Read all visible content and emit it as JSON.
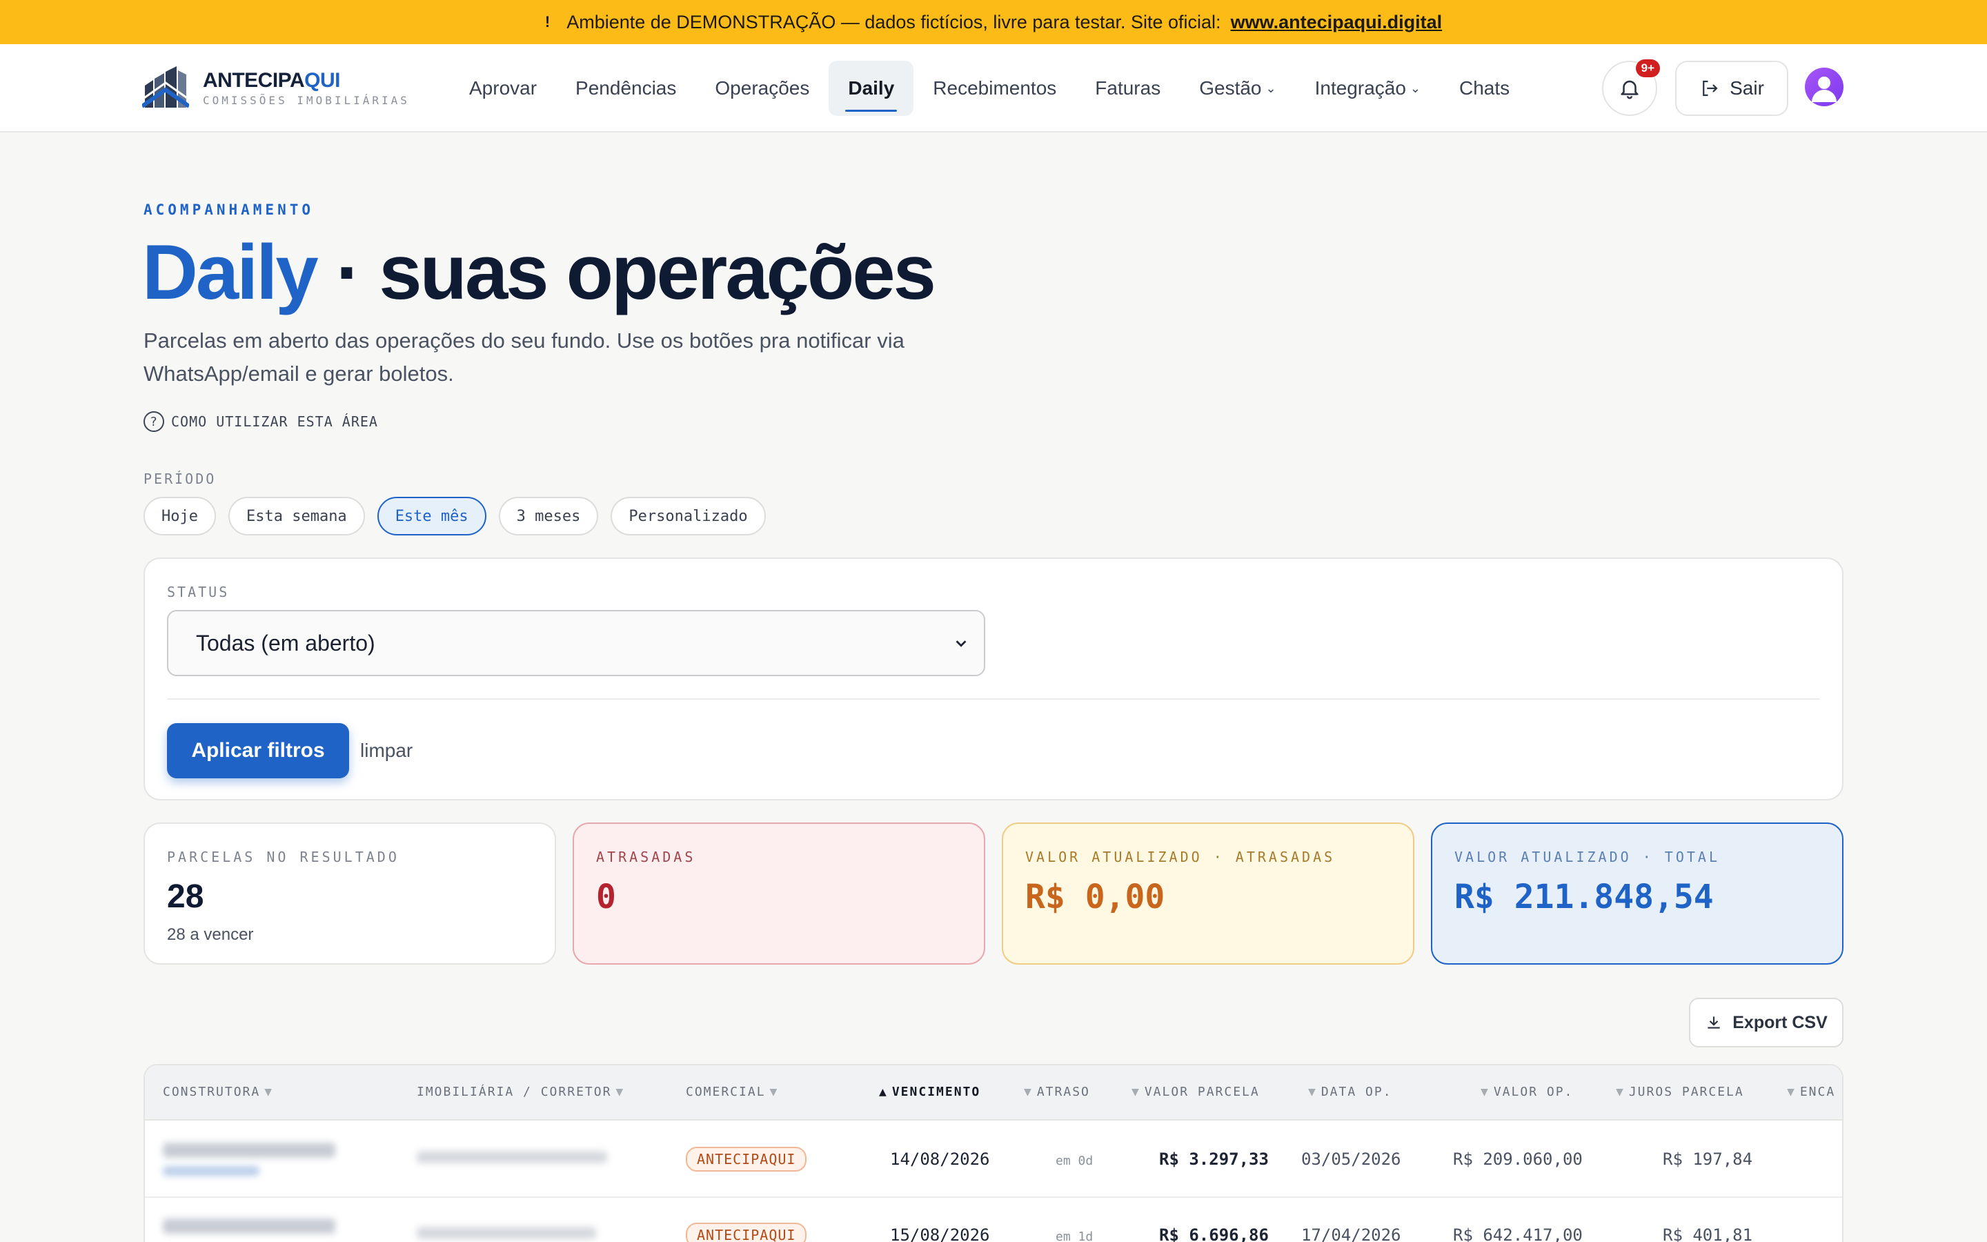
{
  "banner": {
    "text": "Ambiente de DEMONSTRAÇÃO — dados fictícios, livre para testar. Site oficial:",
    "link": "www.antecipaqui.digital",
    "icon": "warning-icon"
  },
  "brand": {
    "name_a": "ANTECIPA",
    "name_b": "QUI",
    "tagline": "COMISSÕES IMOBILIÁRIAS"
  },
  "nav": {
    "items": [
      {
        "label": "Aprovar"
      },
      {
        "label": "Pendências"
      },
      {
        "label": "Operações"
      },
      {
        "label": "Daily",
        "active": true
      },
      {
        "label": "Recebimentos"
      },
      {
        "label": "Faturas"
      },
      {
        "label": "Gestão",
        "dropdown": true
      },
      {
        "label": "Integração",
        "dropdown": true
      },
      {
        "label": "Chats"
      }
    ],
    "notifications_badge": "9+",
    "logout_label": "Sair"
  },
  "header": {
    "eyebrow": "ACOMPANHAMENTO",
    "title_accent": "Daily",
    "title_rest": " · suas operações",
    "subtitle": "Parcelas em aberto das operações do seu fundo. Use os botões pra notificar via WhatsApp/email e gerar boletos.",
    "howto": "COMO UTILIZAR ESTA ÁREA"
  },
  "period": {
    "label": "PERÍODO",
    "options": [
      "Hoje",
      "Esta semana",
      "Este mês",
      "3 meses",
      "Personalizado"
    ],
    "selected": "Este mês"
  },
  "filters": {
    "status_label": "STATUS",
    "status_value": "Todas (em aberto)",
    "apply_label": "Aplicar filtros",
    "clear_label": "limpar"
  },
  "kpis": [
    {
      "label": "PARCELAS NO RESULTADO",
      "value": "28",
      "sub": "28 a vencer"
    },
    {
      "label": "ATRASADAS",
      "value": "0"
    },
    {
      "label": "VALOR ATUALIZADO · ATRASADAS",
      "value": "R$ 0,00"
    },
    {
      "label": "VALOR ATUALIZADO · TOTAL",
      "value": "R$ 211.848,54"
    }
  ],
  "export_label": "Export CSV",
  "table": {
    "columns": [
      "CONSTRUTORA",
      "IMOBILIÁRIA / CORRETOR",
      "COMERCIAL",
      "VENCIMENTO",
      "ATRASO",
      "VALOR PARCELA",
      "DATA OP.",
      "VALOR OP.",
      "JUROS PARCELA",
      "ENCA"
    ],
    "sorted_column": "VENCIMENTO",
    "rows": [
      {
        "comercial": "ANTECIPAQUI",
        "vencimento": "14/08/2026",
        "atraso": "em 0d",
        "valor_parcela": "R$ 3.297,33",
        "data_op": "03/05/2026",
        "valor_op": "R$ 209.060,00",
        "juros": "R$ 197,84"
      },
      {
        "comercial": "ANTECIPAQUI",
        "vencimento": "15/08/2026",
        "atraso": "em 1d",
        "valor_parcela": "R$ 6.696,86",
        "data_op": "17/04/2026",
        "valor_op": "R$ 642.417,00",
        "juros": "R$ 401,81"
      }
    ]
  },
  "colors": {
    "accent": "#1f63c6",
    "banner": "#fdbb17",
    "danger": "#b4232e",
    "warning": "#c7661c"
  }
}
